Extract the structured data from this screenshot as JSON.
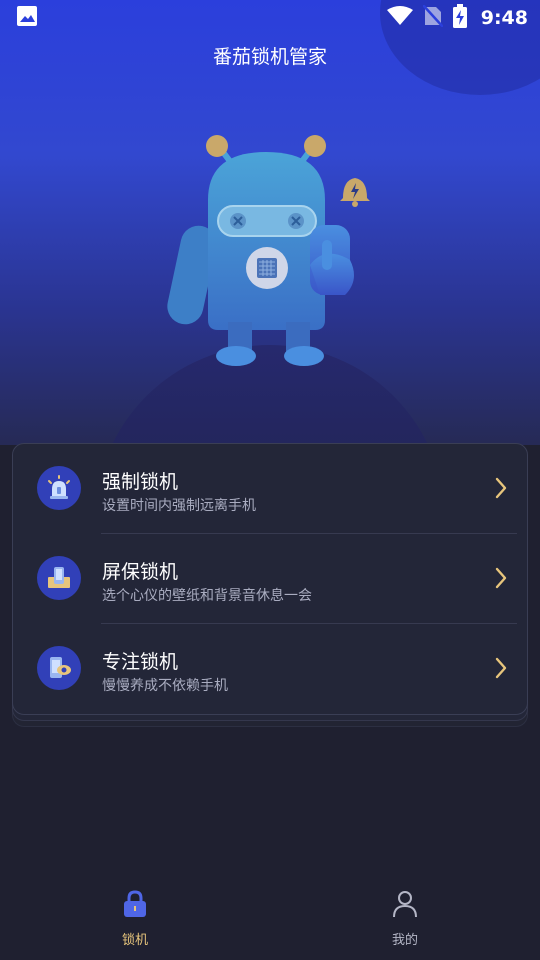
{
  "status_bar": {
    "time": "9:48",
    "icons": [
      "image-icon",
      "wifi-icon",
      "no-sim-icon",
      "battery-charging-icon"
    ]
  },
  "header": {
    "title": "番茄锁机管家"
  },
  "menu": {
    "items": [
      {
        "title": "强制锁机",
        "subtitle": "设置时间内强制远离手机",
        "icon": "alarm-light-icon"
      },
      {
        "title": "屏保锁机",
        "subtitle": "选个心仪的壁纸和背景音休息一会",
        "icon": "phone-stand-icon"
      },
      {
        "title": "专注锁机",
        "subtitle": "慢慢养成不依赖手机",
        "icon": "phone-eye-icon"
      }
    ]
  },
  "bottom_nav": {
    "items": [
      {
        "label": "锁机",
        "icon": "lock-icon",
        "active": true
      },
      {
        "label": "我的",
        "icon": "person-icon",
        "active": false
      }
    ]
  },
  "colors": {
    "accent": "#e7c57c",
    "icon_circle": "#3140b8",
    "background": "#1f2030",
    "card": "#232638",
    "hero_top": "#2b3fdc"
  }
}
